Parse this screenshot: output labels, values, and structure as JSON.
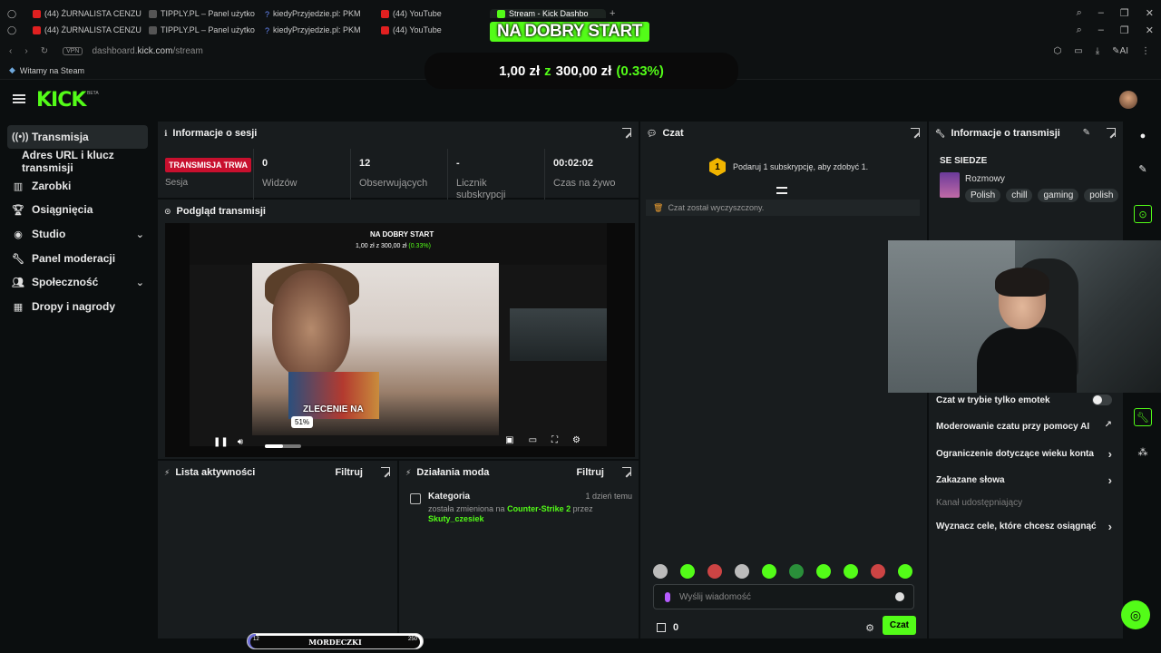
{
  "browser": {
    "tabs_row1": [
      {
        "title": "(44) ŻURNALISTA CENZU",
        "icon": "youtube-icon"
      },
      {
        "title": "TIPPLY.PL – Panel użytko",
        "icon": "tipply-icon"
      },
      {
        "title": "kiedyPrzyjedzie.pl: PKM",
        "icon": "question-icon"
      },
      {
        "title": "(44) YouTube",
        "icon": "youtube-icon"
      },
      {
        "title": "Stream - Kick Dashbo",
        "icon": "kick-icon",
        "active": true
      }
    ],
    "tabs_row2": [
      {
        "title": "(44) ŻURNALISTA CENZU",
        "icon": "youtube-icon"
      },
      {
        "title": "TIPPLY.PL – Panel użytko",
        "icon": "tipply-icon"
      },
      {
        "title": "kiedyPrzyjedzie.pl: PKM",
        "icon": "question-icon"
      },
      {
        "title": "(44) YouTube",
        "icon": "youtube-icon"
      }
    ],
    "vpn": "VPN",
    "url_prefix": "dashboard.",
    "url_domain": "kick.com",
    "url_path": "/stream",
    "bookmark": "Witamy na Steam",
    "ai_label": "AI"
  },
  "overlay": {
    "title": "NA DOBRY START",
    "goal_current": "1,00 zł",
    "goal_sep": "z",
    "goal_target": "300,00 zł",
    "goal_percent": "(0.33%)"
  },
  "kick": {
    "logo": "KICK",
    "beta": "BETA"
  },
  "sidebar": {
    "items": [
      {
        "label": "Transmisja",
        "icon": "broadcast-icon"
      },
      {
        "label": "Adres URL i klucz transmisji"
      },
      {
        "label": "Zarobki",
        "icon": "earnings-icon"
      },
      {
        "label": "Osiągnięcia",
        "icon": "trophy-icon"
      },
      {
        "label": "Studio",
        "icon": "studio-icon"
      },
      {
        "label": "Panel moderacji",
        "icon": "wrench-icon"
      },
      {
        "label": "Społeczność",
        "icon": "community-icon"
      },
      {
        "label": "Dropy i nagrody",
        "icon": "drops-icon"
      }
    ]
  },
  "session": {
    "title": "Informacje o sesji",
    "live_badge": "TRANSMISJA TRWA",
    "live_label": "Sesja",
    "stats": [
      {
        "value": "0",
        "label": "Widzów"
      },
      {
        "value": "12",
        "label": "Obserwujących"
      },
      {
        "value": "-",
        "label": "Licznik subskrypcji"
      },
      {
        "value": "00:02:02",
        "label": "Czas na żywo"
      }
    ]
  },
  "preview": {
    "title": "Podgląd transmisji",
    "inner_title": "NA DOBRY START",
    "inner_goal": "1,00 zł z 300,00 zł",
    "inner_goal_pct": "(0.33%)",
    "thumb_text": "ZLECENIE NA",
    "volume_tip": "51%",
    "volume": 0.51
  },
  "activity": {
    "title": "Lista aktywności",
    "filter": "Filtruj"
  },
  "modactions": {
    "title": "Działania moda",
    "filter": "Filtruj",
    "item": {
      "title": "Kategoria",
      "time": "1 dzień temu",
      "text_pre": "została zmieniona na",
      "category": "Counter-Strike 2",
      "text_mid": "przez",
      "user": "Skuty_czesiek"
    }
  },
  "chat": {
    "title": "Czat",
    "sub_badge": "1",
    "sub_text": "Podaruj 1 subskrypcję, aby zdobyć 1.",
    "cleared": "Czat został wyczyszczony.",
    "placeholder": "Wyślij wiadomość",
    "gift_count": "0",
    "send_label": "Czat"
  },
  "streaminfo": {
    "title": "Informacje o transmisji",
    "stream_title": "SE SIEDZE",
    "category": "Rozmowy",
    "tags": [
      "Polish",
      "chill",
      "gaming",
      "polish"
    ],
    "settings": [
      {
        "label": "Czat w trybie tylko emotek",
        "type": "toggle"
      },
      {
        "label": "Moderowanie czatu przy pomocy AI",
        "type": "link"
      },
      {
        "label": "Ograniczenie dotyczące wieku konta",
        "type": "arrow"
      },
      {
        "label": "Zakazane słowa",
        "type": "arrow"
      },
      {
        "label": "Kanał udostępniający",
        "type": "dim"
      },
      {
        "label": "Wyznacz cele, które chcesz osiągnąć",
        "type": "arrow"
      }
    ]
  },
  "bottom_bar": {
    "label": "MORDECZKI",
    "left_num": "12",
    "right_num": "250",
    "progress": 0.048
  },
  "colors": {
    "accent": "#53fc18",
    "live_red": "#c8102e",
    "sub_gold": "#f0b400"
  }
}
